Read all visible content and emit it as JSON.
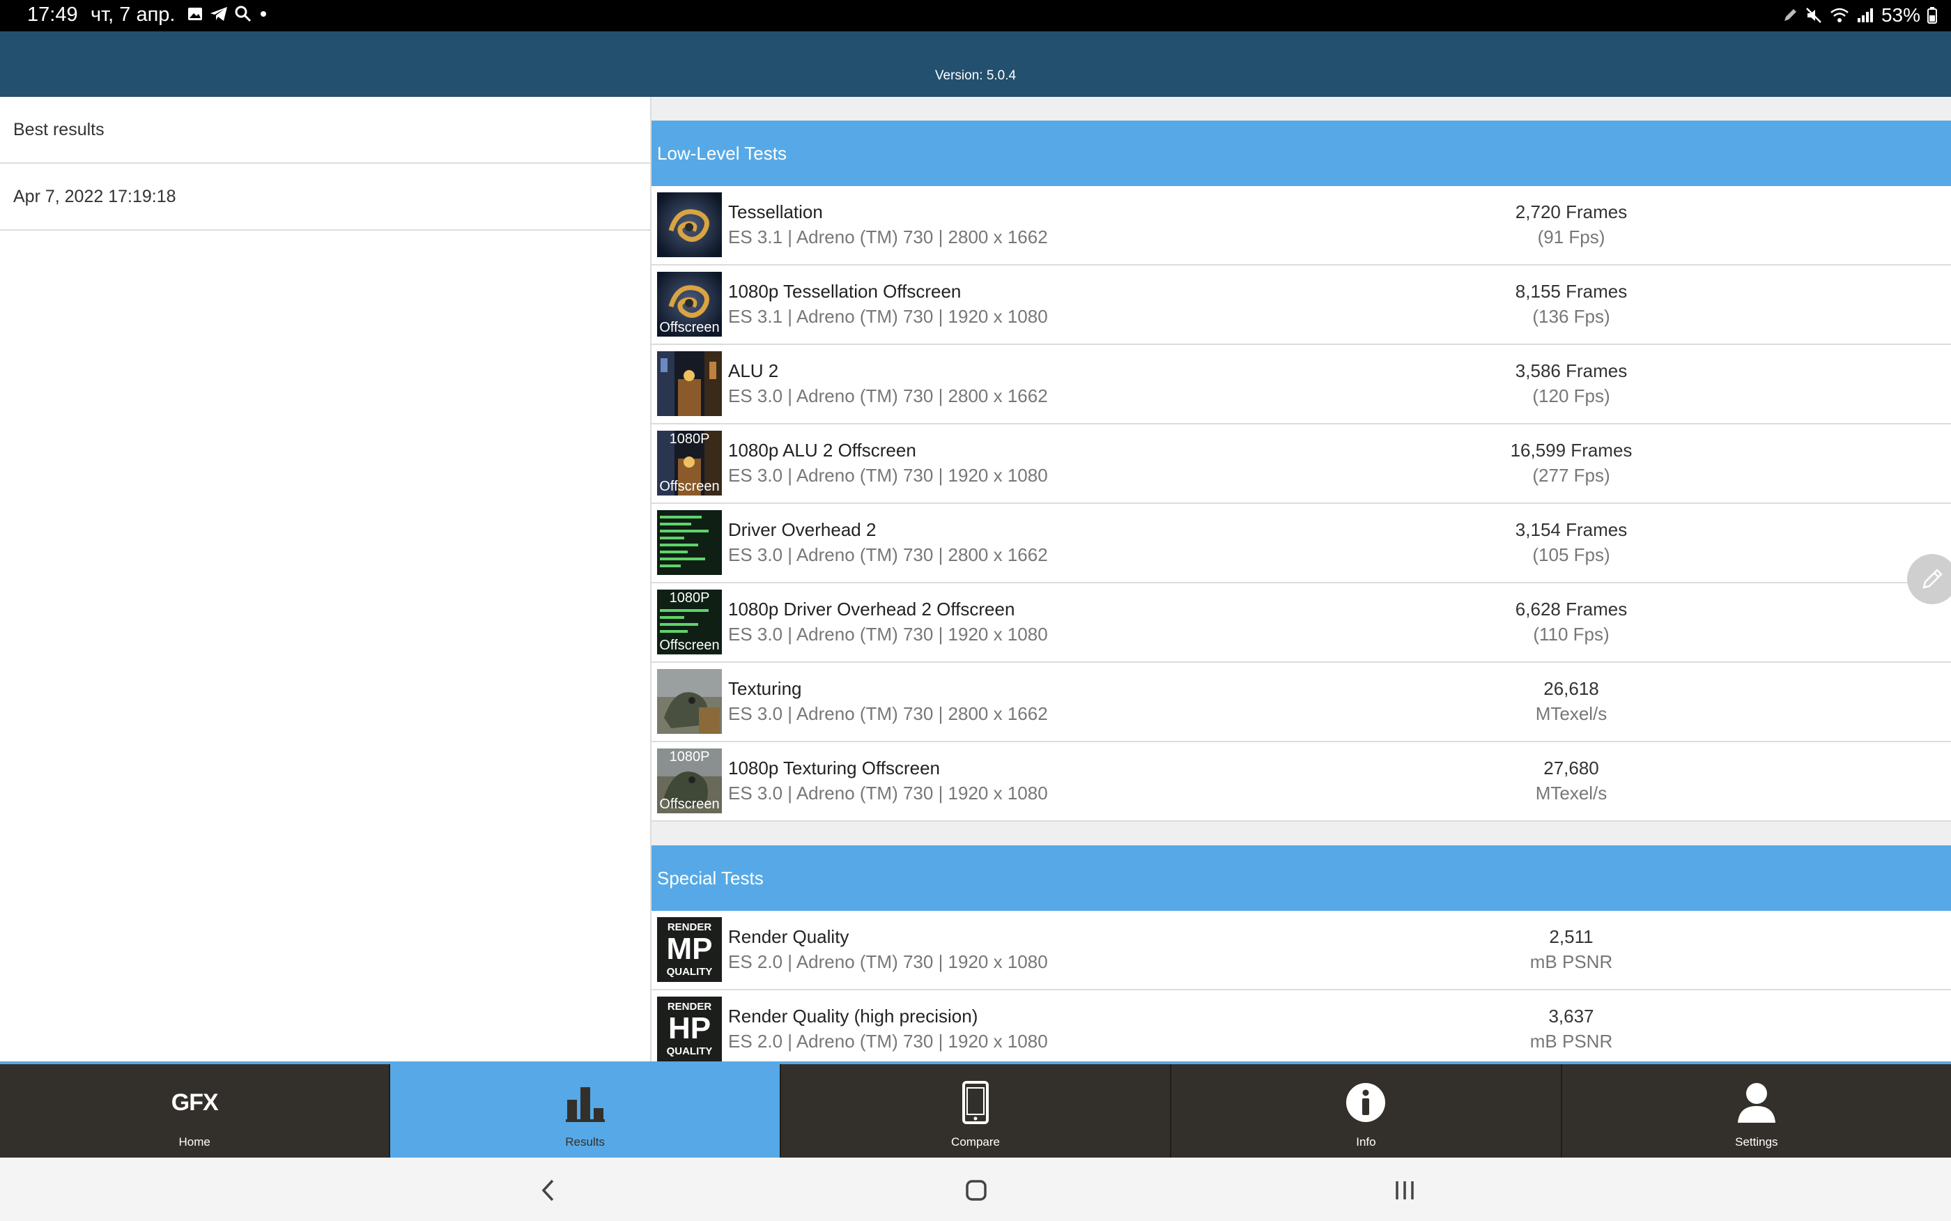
{
  "status_bar": {
    "time": "17:49",
    "date": "чт, 7 апр.",
    "battery": "53%"
  },
  "header": {
    "version": "Version: 5.0.4"
  },
  "left_pane": {
    "items": [
      "Best results",
      "Apr 7, 2022 17:19:18"
    ]
  },
  "sections": {
    "low_level": {
      "title": "Low-Level Tests",
      "tests": [
        {
          "name": "Tessellation",
          "spec": "ES 3.1 | Adreno (TM) 730 | 2800 x 1662",
          "value": "2,720 Frames",
          "unit": "(91 Fps)",
          "badge_top": "",
          "badge_bottom": ""
        },
        {
          "name": "1080p Tessellation Offscreen",
          "spec": "ES 3.1 | Adreno (TM) 730 | 1920 x 1080",
          "value": "8,155 Frames",
          "unit": "(136 Fps)",
          "badge_top": "",
          "badge_bottom": "Offscreen"
        },
        {
          "name": "ALU 2",
          "spec": "ES 3.0 | Adreno (TM) 730 | 2800 x 1662",
          "value": "3,586 Frames",
          "unit": "(120 Fps)",
          "badge_top": "",
          "badge_bottom": ""
        },
        {
          "name": "1080p ALU 2 Offscreen",
          "spec": "ES 3.0 | Adreno (TM) 730 | 1920 x 1080",
          "value": "16,599 Frames",
          "unit": "(277 Fps)",
          "badge_top": "1080P",
          "badge_bottom": "Offscreen"
        },
        {
          "name": "Driver Overhead 2",
          "spec": "ES 3.0 | Adreno (TM) 730 | 2800 x 1662",
          "value": "3,154 Frames",
          "unit": "(105 Fps)",
          "badge_top": "",
          "badge_bottom": ""
        },
        {
          "name": "1080p Driver Overhead 2 Offscreen",
          "spec": "ES 3.0 | Adreno (TM) 730 | 1920 x 1080",
          "value": "6,628 Frames",
          "unit": "(110 Fps)",
          "badge_top": "1080P",
          "badge_bottom": "Offscreen"
        },
        {
          "name": "Texturing",
          "spec": "ES 3.0 | Adreno (TM) 730 | 2800 x 1662",
          "value": "26,618",
          "unit": "MTexel/s",
          "badge_top": "",
          "badge_bottom": ""
        },
        {
          "name": "1080p Texturing Offscreen",
          "spec": "ES 3.0 | Adreno (TM) 730 | 1920 x 1080",
          "value": "27,680",
          "unit": "MTexel/s",
          "badge_top": "1080P",
          "badge_bottom": "Offscreen"
        }
      ]
    },
    "special": {
      "title": "Special Tests",
      "tests": [
        {
          "name": "Render Quality",
          "spec": "ES 2.0 | Adreno (TM) 730 | 1920 x 1080",
          "value": "2,511",
          "unit": "mB PSNR",
          "badge_top": "RENDER",
          "badge_mid": "MP",
          "badge_bottom": "QUALITY"
        },
        {
          "name": "Render Quality (high precision)",
          "spec": "ES 2.0 | Adreno (TM) 730 | 1920 x 1080",
          "value": "3,637",
          "unit": "mB PSNR",
          "badge_top": "RENDER",
          "badge_mid": "HP",
          "badge_bottom": "QUALITY"
        }
      ]
    }
  },
  "tabbar": {
    "home_logo": "GFX",
    "tabs": [
      "Home",
      "Results",
      "Compare",
      "Info",
      "Settings"
    ]
  },
  "colors": {
    "accent": "#56a9e6",
    "header": "#24506f",
    "tabbar": "#33302b"
  }
}
